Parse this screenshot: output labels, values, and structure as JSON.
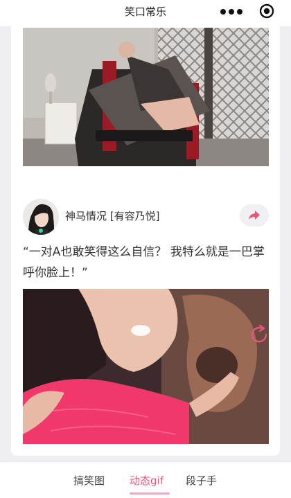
{
  "nav": {
    "title": "笑口常乐",
    "more_icon": "more-dots-icon",
    "target_icon": "target-icon"
  },
  "posts": [
    {
      "media_alt": "gif-bed-prank"
    },
    {
      "author": "神马情况 [有容乃悦]",
      "caption": "“一对A也敢笑得这么自信？ 我特么就是一巴掌呼你脸上！”",
      "share_icon": "share-arrow-icon",
      "replay_icon": "replay-icon",
      "accent": "#e8557a"
    }
  ],
  "tabs": [
    {
      "label": "搞笑图",
      "active": false
    },
    {
      "label": "动态gif",
      "active": true
    },
    {
      "label": "段子手",
      "active": false
    }
  ]
}
